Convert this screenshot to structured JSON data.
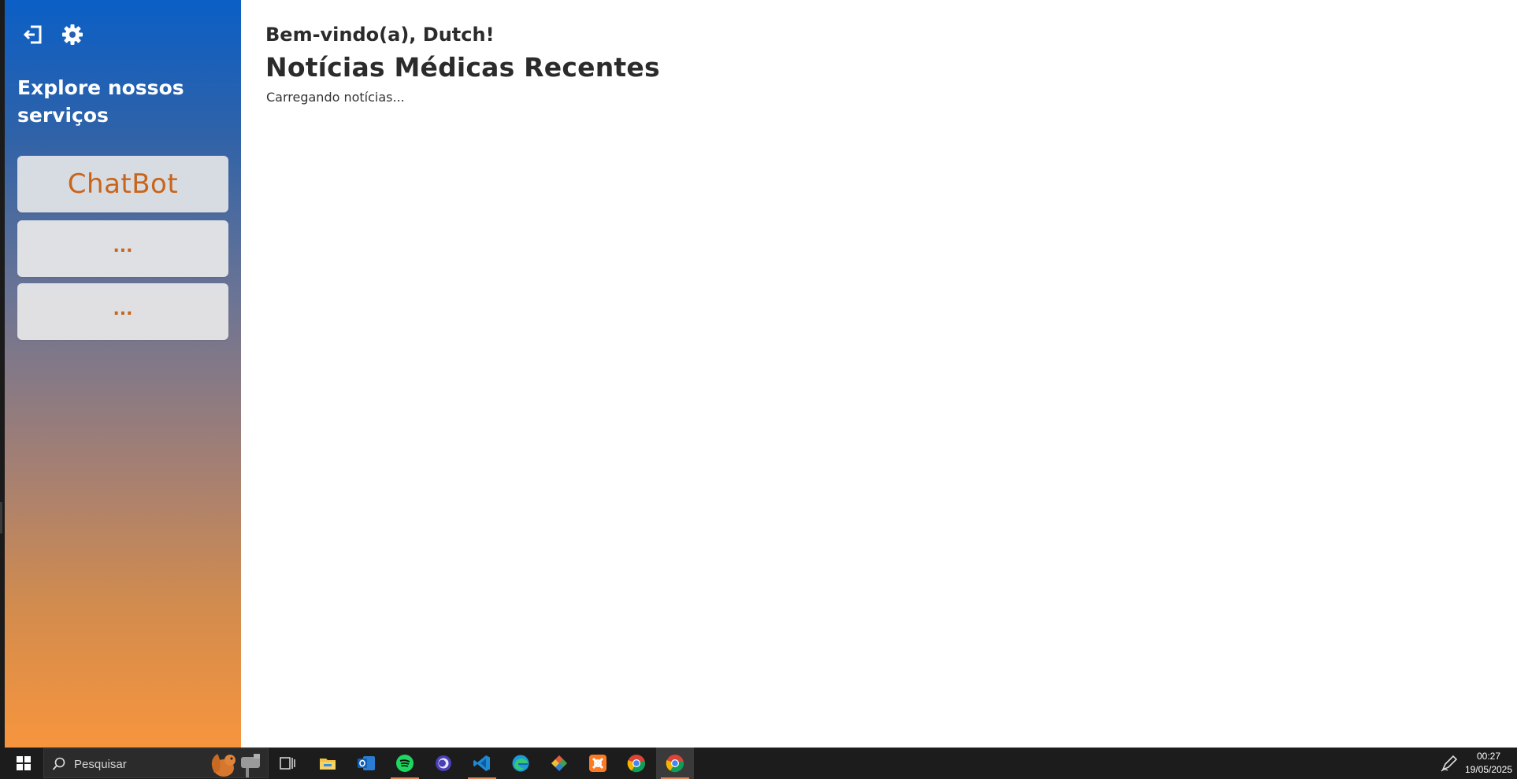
{
  "sidebar": {
    "title": "Explore nossos serviços",
    "services": [
      {
        "label": "ChatBot"
      },
      {
        "label": "..."
      },
      {
        "label": "..."
      }
    ],
    "icons": [
      "logout-icon",
      "gear-icon"
    ]
  },
  "main": {
    "welcome": "Bem-vindo(a), Dutch!",
    "news_title": "Notícias Médicas Recentes",
    "loading_text": "Carregando notícias..."
  },
  "taskbar": {
    "search_placeholder": "Pesquisar",
    "apps": [
      "task-view",
      "file-explorer",
      "outlook",
      "spotify",
      "app-purple",
      "vscode",
      "edge",
      "git-app",
      "xampp",
      "chrome",
      "chrome"
    ],
    "time": "00:27",
    "date": "19/05/2025"
  },
  "colors": {
    "sidebar_top": "#0b5fc6",
    "sidebar_bottom": "#f7953e",
    "card_text": "#c9641b",
    "heading_text": "#2b2b2b",
    "taskbar_bg": "#1c1c1c"
  }
}
